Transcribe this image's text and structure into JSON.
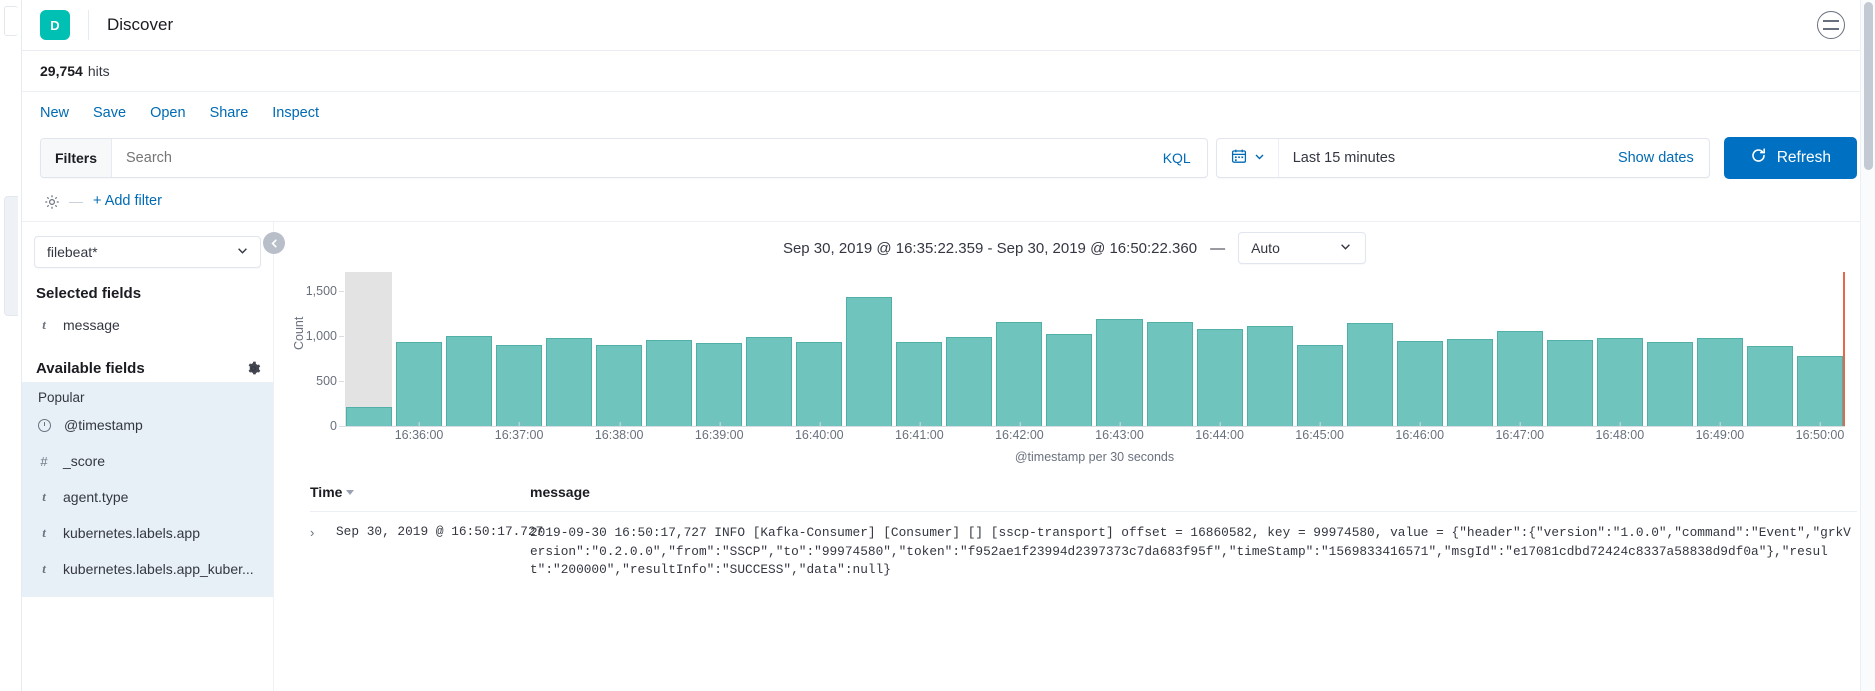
{
  "header": {
    "logo_initial": "D",
    "title": "Discover",
    "right_icon": "global-nav-icon"
  },
  "hits": {
    "count": "29,754",
    "label": "hits"
  },
  "actions": [
    {
      "label": "New"
    },
    {
      "label": "Save"
    },
    {
      "label": "Open"
    },
    {
      "label": "Share"
    },
    {
      "label": "Inspect"
    }
  ],
  "query_bar": {
    "filters_label": "Filters",
    "search_placeholder": "Search",
    "language_label": "KQL",
    "date_value": "Last 15 minutes",
    "show_dates_label": "Show dates",
    "refresh_label": "Refresh"
  },
  "filter_row": {
    "add_filter_label": "+ Add filter",
    "separator": "—"
  },
  "sidebar": {
    "index_pattern": "filebeat*",
    "selected_fields_title": "Selected fields",
    "selected_fields": [
      {
        "type": "t",
        "name": "message"
      }
    ],
    "available_fields_title": "Available fields",
    "popular_label": "Popular",
    "popular_fields": [
      {
        "type": "date",
        "name": "@timestamp"
      },
      {
        "type": "#",
        "name": "_score"
      },
      {
        "type": "t",
        "name": "agent.type"
      },
      {
        "type": "t",
        "name": "kubernetes.labels.app"
      },
      {
        "type": "t",
        "name": "kubernetes.labels.app_kuber..."
      }
    ]
  },
  "chart_panel": {
    "time_range": "Sep 30, 2019 @ 16:35:22.359 - Sep 30, 2019 @ 16:50:22.360",
    "separator": "—",
    "interval": "Auto"
  },
  "chart_data": {
    "type": "bar",
    "title": "",
    "xlabel": "@timestamp per 30 seconds",
    "ylabel": "Count",
    "ylim": [
      0,
      1600
    ],
    "yticks": [
      0,
      500,
      1000,
      1500
    ],
    "ytick_labels": [
      "0",
      "500",
      "1,000",
      "1,500"
    ],
    "xtick_labels": [
      "16:36:00",
      "16:37:00",
      "16:38:00",
      "16:39:00",
      "16:40:00",
      "16:41:00",
      "16:42:00",
      "16:43:00",
      "16:44:00",
      "16:45:00",
      "16:46:00",
      "16:47:00",
      "16:48:00",
      "16:49:00",
      "16:50:00"
    ],
    "bar_color": "#6fc4bd",
    "bar_stroke": "#50b0a8",
    "partial_bucket_color": "#e3e3e3",
    "annotation_line_color": "#e7664c",
    "grid": false,
    "legend": "none",
    "categories": [
      "16:35:30",
      "16:36:00",
      "16:36:30",
      "16:37:00",
      "16:37:30",
      "16:38:00",
      "16:38:30",
      "16:39:00",
      "16:39:30",
      "16:40:00",
      "16:40:30",
      "16:41:00",
      "16:41:30",
      "16:42:00",
      "16:42:30",
      "16:43:00",
      "16:43:30",
      "16:44:00",
      "16:44:30",
      "16:45:00",
      "16:45:30",
      "16:46:00",
      "16:46:30",
      "16:47:00",
      "16:47:30",
      "16:48:00",
      "16:48:30",
      "16:49:00",
      "16:49:30",
      "16:50:00"
    ],
    "values": [
      210,
      935,
      1005,
      900,
      975,
      895,
      960,
      925,
      985,
      930,
      1430,
      930,
      985,
      1160,
      1020,
      1185,
      1155,
      1075,
      1110,
      905,
      1140,
      945,
      965,
      1055,
      955,
      980,
      930,
      975,
      890,
      775
    ],
    "partial_buckets": [
      0
    ]
  },
  "doc_table": {
    "columns": [
      {
        "key": "time",
        "label": "Time",
        "sorted": true
      },
      {
        "key": "message",
        "label": "message",
        "sorted": false
      }
    ],
    "rows": [
      {
        "time": "Sep 30, 2019 @ 16:50:17.727",
        "message": "2019-09-30 16:50:17,727 INFO [Kafka-Consumer] [Consumer] [] [sscp-transport] offset = 16860582, key = 99974580, value = {\"header\":{\"version\":\"1.0.0\",\"command\":\"Event\",\"grkVersion\":\"0.2.0.0\",\"from\":\"SSCP\",\"to\":\"99974580\",\"token\":\"f952ae1f23994d2397373c7da683f95f\",\"timeStamp\":\"1569833416571\",\"msgId\":\"e17081cdbd72424c8337a58838d9df0a\"},\"result\":\"200000\",\"resultInfo\":\"SUCCESS\",\"data\":null}"
      }
    ]
  }
}
